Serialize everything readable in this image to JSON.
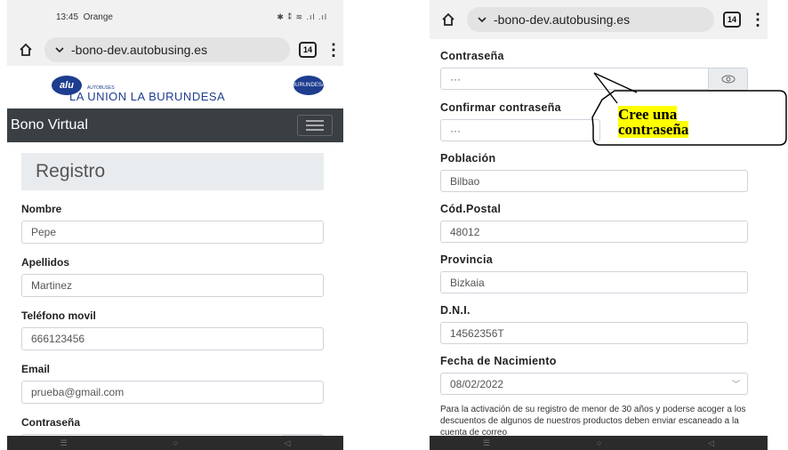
{
  "left": {
    "status": {
      "time": "13:45",
      "carrier": "Orange",
      "right_icons": "✱ ⁑ ≋ .ıl .ıl"
    },
    "url": "-bono-dev.autobusing.es",
    "tabs_count": "14",
    "brand": {
      "name": "LA UNION LA BURUNDESA",
      "sub": "AUTOBUSES",
      "logo_left": "alu",
      "logo_right": "BURUNDESA"
    },
    "navbar_title": "Bono Virtual",
    "page_title": "Registro",
    "fields": [
      {
        "label": "Nombre",
        "value": "Pepe"
      },
      {
        "label": "Apellidos",
        "value": "Martinez"
      },
      {
        "label": "Teléfono movil",
        "value": "666123456"
      },
      {
        "label": "Email",
        "value": "prueba@gmail.com"
      }
    ],
    "password_label": "Contraseña",
    "password_value": ""
  },
  "right": {
    "url": "-bono-dev.autobusing.es",
    "tabs_count": "14",
    "password_label": "Contraseña",
    "password_value": "···",
    "confirm_label": "Confirmar contraseña",
    "confirm_value": "···",
    "fields": [
      {
        "label": "Población",
        "value": "Bilbao"
      },
      {
        "label": "Cód.Postal",
        "value": "48012"
      },
      {
        "label": "Provincia",
        "value": "Bizkaia"
      },
      {
        "label": "D.N.I.",
        "value": "14562356T"
      }
    ],
    "birth_label": "Fecha de Nacimiento",
    "birth_value": "08/02/2022",
    "info": "Para la activación de su registro de menor de 30 años y poderse acoger a los descuentos de algunos de nuestros productos deben enviar escaneado a la cuenta de correo"
  },
  "callout_text": "Cree una contraseña"
}
